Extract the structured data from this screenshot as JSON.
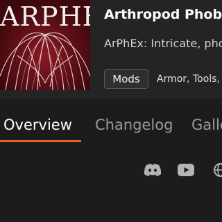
{
  "project": {
    "logo_text": "ARPHEX",
    "title": "Arthropod Phobia Expansions",
    "summary": "ArPhEx: Intricate, phobia-inducing arthropods",
    "tag": "Mods",
    "categories": "Armor, Tools, and Weapons"
  },
  "tabs": [
    {
      "label": "Overview",
      "active": true
    },
    {
      "label": "Changelog",
      "active": false
    },
    {
      "label": "Gallery",
      "active": false
    }
  ],
  "external_links": [
    {
      "icon": "discord-icon"
    },
    {
      "icon": "youtube-icon"
    },
    {
      "icon": "globe-icon"
    }
  ],
  "colors": {
    "background": "#1c1c1c",
    "header_background": "#242424",
    "active_tab_underline": "#e8602c",
    "logo_background": "#5a0f16"
  }
}
